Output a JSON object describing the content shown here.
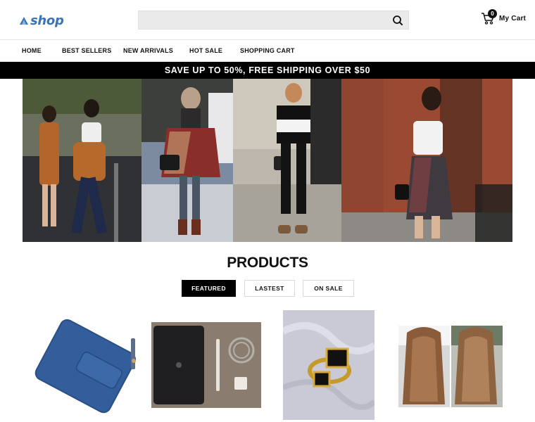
{
  "header": {
    "logo_text": "shop",
    "search_placeholder": "",
    "cart_count": "0",
    "cart_label": "My Cart"
  },
  "nav": {
    "items": [
      {
        "label": "HOME"
      },
      {
        "label": "BEST SELLERS"
      },
      {
        "label": "NEW ARRIVALS"
      },
      {
        "label": "HOT SALE"
      },
      {
        "label": "SHOPPING CART"
      }
    ]
  },
  "promo": {
    "text": "SAVE UP TO 50%, FREE SHIPPING OVER $50"
  },
  "products": {
    "title": "PRODUCTS",
    "tabs": [
      {
        "label": "FEATURED",
        "active": true
      },
      {
        "label": "LASTEST",
        "active": false
      },
      {
        "label": "ON SALE",
        "active": false
      }
    ]
  },
  "colors": {
    "brand": "#3b73b9",
    "promo_bg": "#000000",
    "search_bg": "#eaeaea"
  },
  "icons": [
    "logo-mark-icon",
    "search-icon",
    "cart-icon"
  ]
}
